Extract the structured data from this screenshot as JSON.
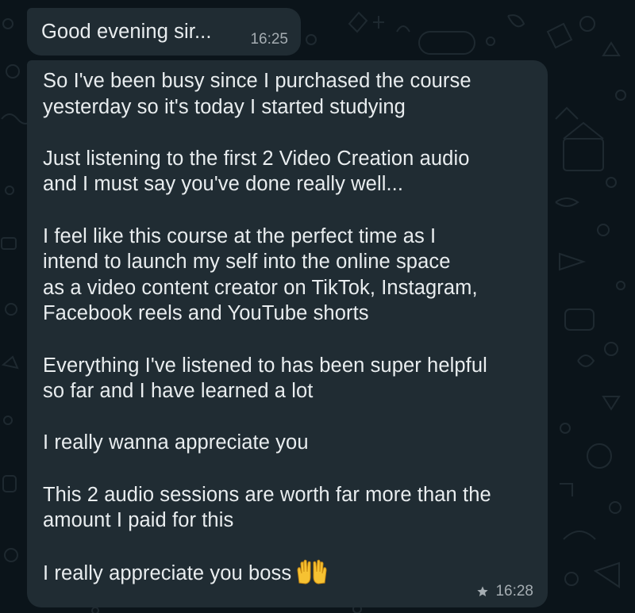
{
  "colors": {
    "background": "#0b141a",
    "bubble": "#202c33",
    "text": "#e9edef",
    "meta": "#a5adb2",
    "doodle": "#2f3b42"
  },
  "messages": [
    {
      "text": "Good evening sir...",
      "time": "16:25",
      "starred": false
    },
    {
      "paragraphs": [
        "So I've been busy since I purchased the course\nyesterday so it's today I started studying",
        "Just listening to the first 2 Video Creation audio\nand I must say you've done really well...",
        "I feel like this course at the perfect time as I\nintend to launch my self into the online space\nas a video content creator on TikTok, Instagram,\nFacebook reels and YouTube shorts",
        "Everything I've listened to has been super helpful\nso far and I have learned a lot",
        "I really wanna appreciate you",
        "This 2 audio sessions are worth far more than the\namount I paid for this",
        "I really appreciate you boss"
      ],
      "emoji": "palms-up-together-emoji",
      "time": "16:28",
      "starred": true,
      "star_icon": "star-icon"
    }
  ]
}
